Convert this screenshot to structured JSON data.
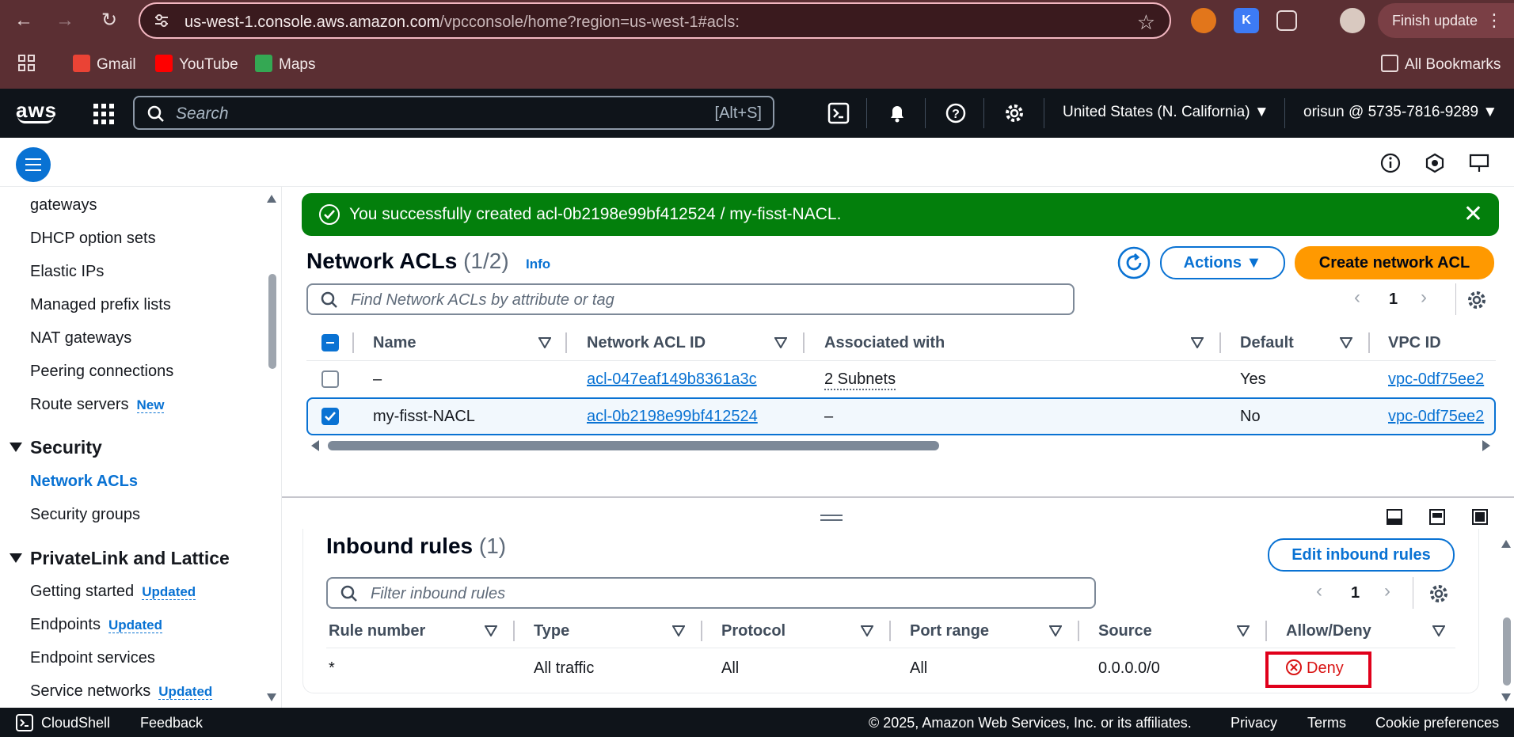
{
  "browser": {
    "url_host": "us-west-1.console.aws.amazon.com",
    "url_path": "/vpcconsole/home?region=us-west-1#acls:",
    "finish_update": "Finish update",
    "bookmarks": [
      "Gmail",
      "YouTube",
      "Maps"
    ],
    "all_bookmarks": "All Bookmarks"
  },
  "aws": {
    "logo": "aws",
    "search_placeholder": "Search",
    "search_shortcut": "[Alt+S]",
    "region": "United States (N. California) ▼",
    "account": "orisun @ 5735-7816-9289 ▼"
  },
  "sidebar": {
    "items_top": [
      "gateways",
      "DHCP option sets",
      "Elastic IPs",
      "Managed prefix lists",
      "NAT gateways",
      "Peering connections",
      "Route servers"
    ],
    "route_servers_badge": "New",
    "security_header": "Security",
    "security_items": [
      "Network ACLs",
      "Security groups"
    ],
    "privatelink_header": "PrivateLink and Lattice",
    "privatelink_items": [
      "Getting started",
      "Endpoints",
      "Endpoint services",
      "Service networks"
    ],
    "updated_badge": "Updated"
  },
  "flash": {
    "message": "You successfully created acl-0b2198e99bf412524 / my-fisst-NACL."
  },
  "acls": {
    "title": "Network ACLs",
    "count": "(1/2)",
    "info": "Info",
    "actions": "Actions ▼",
    "create": "Create network ACL",
    "filter_placeholder": "Find Network ACLs by attribute or tag",
    "page": "1",
    "columns": [
      "Name",
      "Network ACL ID",
      "Associated with",
      "Default",
      "VPC ID"
    ],
    "rows": [
      {
        "name": "–",
        "id": "acl-047eaf149b8361a3c",
        "assoc": "2 Subnets",
        "default": "Yes",
        "vpc": "vpc-0df75ee2"
      },
      {
        "name": "my-fisst-NACL",
        "id": "acl-0b2198e99bf412524",
        "assoc": "–",
        "default": "No",
        "vpc": "vpc-0df75ee2"
      }
    ]
  },
  "inbound": {
    "title": "Inbound rules",
    "count": "(1)",
    "edit": "Edit inbound rules",
    "filter_placeholder": "Filter inbound rules",
    "page": "1",
    "columns": [
      "Rule number",
      "Type",
      "Protocol",
      "Port range",
      "Source",
      "Allow/Deny"
    ],
    "row": {
      "rule": "*",
      "type": "All traffic",
      "protocol": "All",
      "port": "All",
      "source": "0.0.0.0/0",
      "action": "Deny"
    }
  },
  "footer": {
    "cloudshell": "CloudShell",
    "feedback": "Feedback",
    "copyright": "© 2025, Amazon Web Services, Inc. or its affiliates.",
    "privacy": "Privacy",
    "terms": "Terms",
    "cookies": "Cookie preferences"
  },
  "colors": {
    "accent": "#0972d3",
    "primary": "#ff9900",
    "success": "#037f0c",
    "danger": "#d91515"
  }
}
